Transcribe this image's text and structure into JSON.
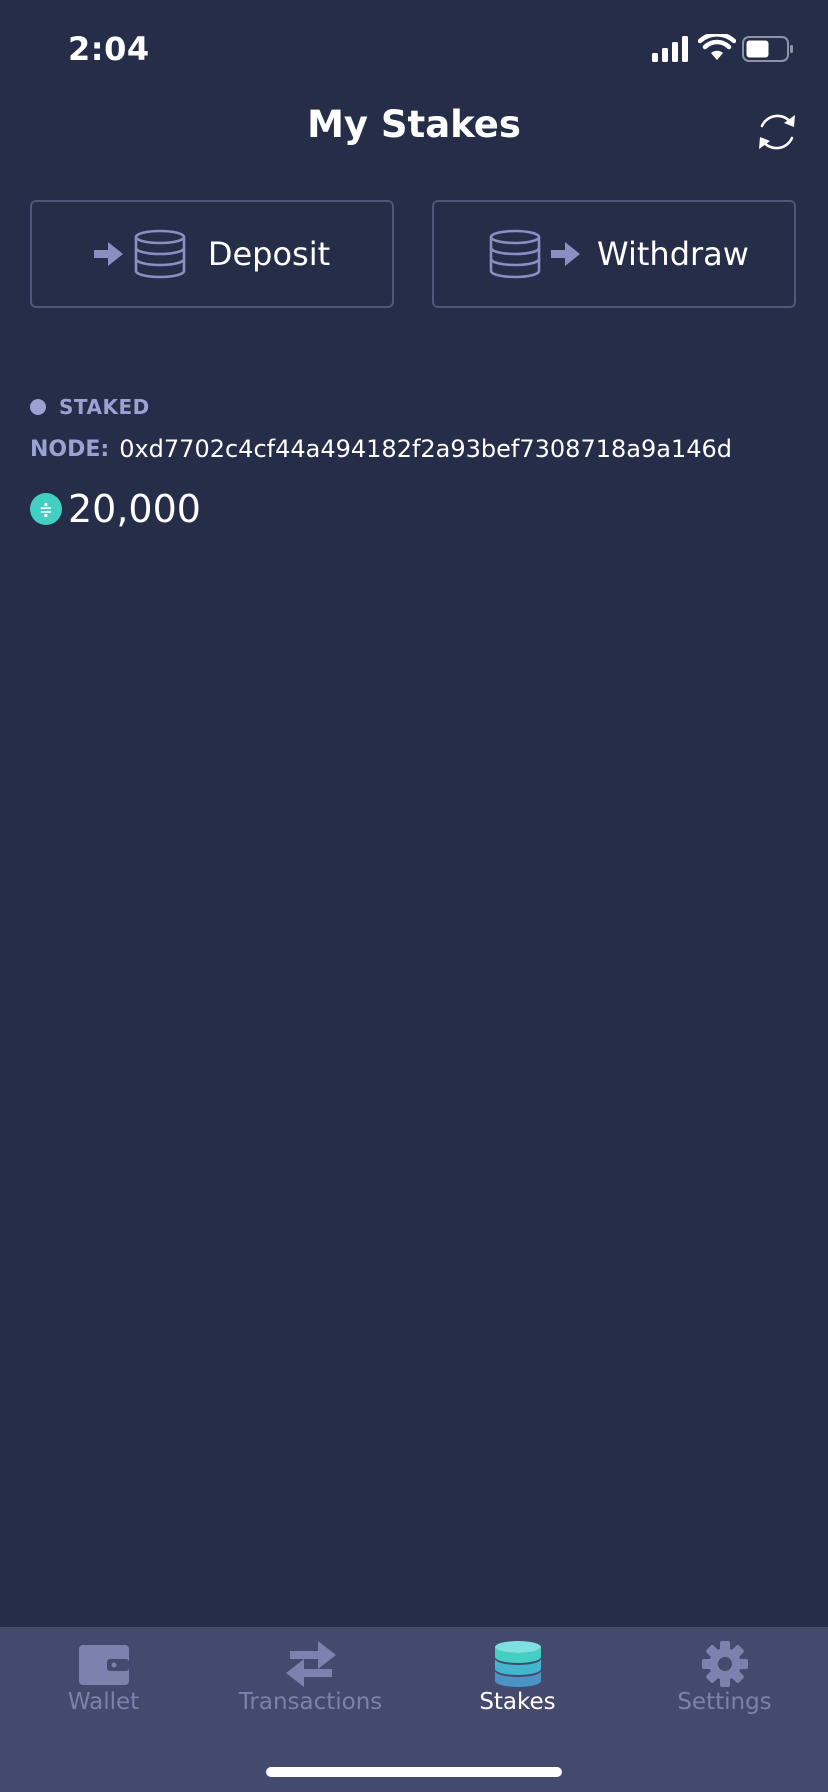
{
  "status_bar": {
    "time": "2:04"
  },
  "header": {
    "title": "My Stakes",
    "refresh_icon": "refresh-icon"
  },
  "actions": {
    "deposit_label": "Deposit",
    "withdraw_label": "Withdraw"
  },
  "stake": {
    "status": "STAKED",
    "node_label": "NODE:",
    "node_address": "0xd7702c4cf44a494182f2a93bef7308718a9a146d",
    "amount": "20,000"
  },
  "tabs": [
    {
      "label": "Wallet",
      "icon": "wallet-icon",
      "active": false
    },
    {
      "label": "Transactions",
      "icon": "transfer-arrows-icon",
      "active": false
    },
    {
      "label": "Stakes",
      "icon": "coin-stack-icon",
      "active": true
    },
    {
      "label": "Settings",
      "icon": "gear-icon",
      "active": false
    }
  ],
  "colors": {
    "background": "#262d49",
    "tabbar": "#434a6d",
    "muted": "#9aa2d3",
    "accent": "#44cfc5",
    "inactive_tab": "#7b82ad"
  }
}
